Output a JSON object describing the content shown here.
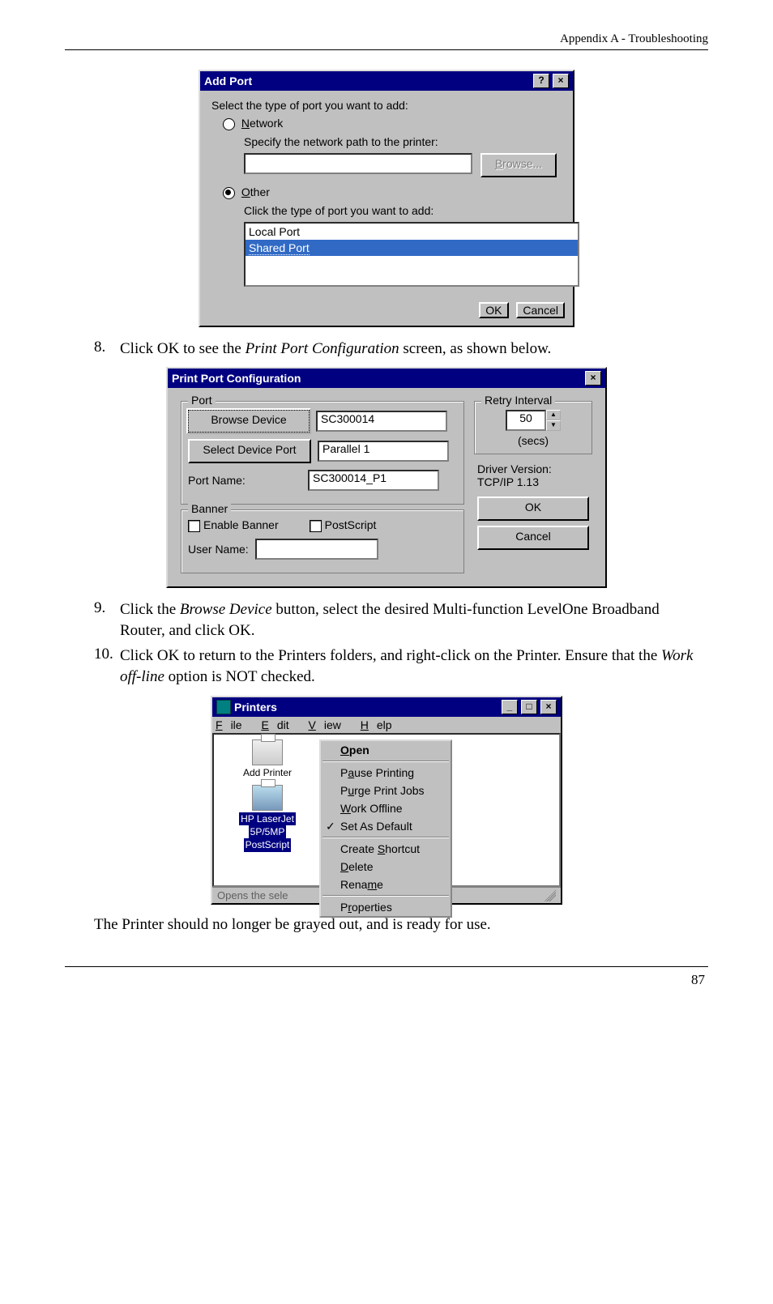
{
  "header": {
    "text": "Appendix A - Troubleshooting"
  },
  "dlg_addport": {
    "title": "Add Port",
    "help_btn": "?",
    "close_btn": "×",
    "prompt": "Select the type of port you want to add:",
    "opt_network_prefix": "N",
    "opt_network_rest": "etwork",
    "network_hint": "Specify the network path to the printer:",
    "browse_prefix": "B",
    "browse_rest": "rowse...",
    "opt_other_prefix": "O",
    "opt_other_rest": "ther",
    "other_hint": "Click the type of port you want to add:",
    "list_item_local": "Local Port",
    "list_item_shared": "Shared Port",
    "ok": "OK",
    "cancel": "Cancel"
  },
  "step8": {
    "num": "8.",
    "text_before": "Click OK to see the ",
    "text_italic": "Print Port Configuration",
    "text_after": " screen, as shown below."
  },
  "dlg_ppc": {
    "title": "Print Port Configuration",
    "close_btn": "×",
    "grp_port": "Port",
    "btn_browse_dev": "Browse Device",
    "val_device": "SC300014",
    "btn_sel_port": "Select Device Port",
    "val_port": "Parallel 1",
    "lbl_port_name": "Port Name:",
    "val_port_name": "SC300014_P1",
    "grp_banner": "Banner",
    "chk_enable_banner": "Enable Banner",
    "chk_postscript": "PostScript",
    "lbl_username": "User Name:",
    "grp_retry": "Retry Interval",
    "val_retry": "50",
    "secs": "(secs)",
    "driver_version_lbl": "Driver Version:",
    "driver_version_val": "TCP/IP  1.13",
    "ok": "OK",
    "cancel": "Cancel"
  },
  "step9": {
    "num": "9.",
    "text_before": "Click the ",
    "text_italic": "Browse Device",
    "text_after": " button, select the desired Multi-function LevelOne Broadband Router, and click OK."
  },
  "step10": {
    "num": "10.",
    "text_before": "Click OK to return to the Printers folders, and right-click on the Printer. Ensure that the ",
    "text_italic": "Work off-line",
    "text_after": " option is NOT checked."
  },
  "dlg_printers": {
    "title": "Printers",
    "min_btn": "_",
    "max_btn": "□",
    "close_btn": "×",
    "menu_file_p": "F",
    "menu_file_r": "ile",
    "menu_edit_p": "E",
    "menu_edit_r": "dit",
    "menu_view_p": "V",
    "menu_view_r": "iew",
    "menu_help_p": "H",
    "menu_help_r": "elp",
    "icon_add": "Add Printer",
    "icon_sel_line1": "HP LaserJet",
    "icon_sel_line2": "5P/5MP",
    "icon_sel_line3": "PostScript",
    "ctx_open_p": "O",
    "ctx_open_r": "pen",
    "ctx_pause_p": "a",
    "ctx_pause_pre": "P",
    "ctx_pause_post": "use Printing",
    "ctx_purge_p": "u",
    "ctx_purge_pre": "P",
    "ctx_purge_post": "rge Print Jobs",
    "ctx_work_p": "W",
    "ctx_work_r": "ork Offline",
    "ctx_default": "Set As Default",
    "ctx_shortcut_p": "S",
    "ctx_shortcut_pre": "Create ",
    "ctx_shortcut_post": "hortcut",
    "ctx_delete_p": "D",
    "ctx_delete_r": "elete",
    "ctx_rename_p": "m",
    "ctx_rename_pre": "Rena",
    "ctx_rename_post": "e",
    "ctx_props_p": "r",
    "ctx_props_pre": "P",
    "ctx_props_post": "operties",
    "status": "Opens the sele"
  },
  "ending_text": "The Printer should no longer be grayed out, and is ready for use.",
  "page_number": "87"
}
